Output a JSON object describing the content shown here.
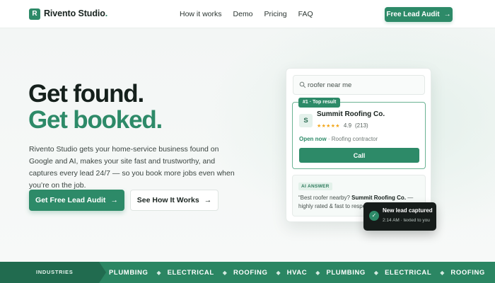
{
  "brand": {
    "logo_letter": "R",
    "name": "Rivento Studio",
    "name_suffix": ".",
    "accent": "#2d8a68"
  },
  "nav": {
    "links": [
      "How it works",
      "Demo",
      "Pricing",
      "FAQ"
    ],
    "cta_label": "Free Lead Audit",
    "cta_arrow": "→"
  },
  "hero": {
    "title_line1": "Get found.",
    "title_line2": "Get booked.",
    "lead": "Rivento Studio gets your home-service business found on Google and AI, makes your site fast and trustworthy, and captures every lead 24/7 — so you book more jobs even when you’re on the job.",
    "primary_label": "Get Free Lead Audit",
    "primary_arrow": "→",
    "secondary_label": "See How It Works",
    "secondary_arrow": "→"
  },
  "mockup": {
    "search_query": "roofer near me",
    "badge": "#1 · Top result",
    "avatar_letter": "S",
    "business_name": "Summit Roofing Co.",
    "stars": "★★★★★",
    "rating": "4.9",
    "review_count": "(213)",
    "status_open": "Open now",
    "status_rest": " · Roofing contractor",
    "call_label": "Call",
    "ai_label": "AI ANSWER",
    "ai_text_before": "“Best roofer nearby? ",
    "ai_text_bold": "Summit Roofing Co.",
    "ai_text_after": " — highly rated & fast to respo"
  },
  "toast": {
    "check": "✓",
    "title": "New lead captured",
    "subtitle": "2:14 AM · texted to you"
  },
  "industries": {
    "label": "INDUSTRIES SERVED",
    "separator": "◆",
    "items": [
      "PLUMBING",
      "ELECTRICAL",
      "ROOFING",
      "HVAC",
      "PLUMBING",
      "ELECTRICAL",
      "ROOFING"
    ]
  }
}
